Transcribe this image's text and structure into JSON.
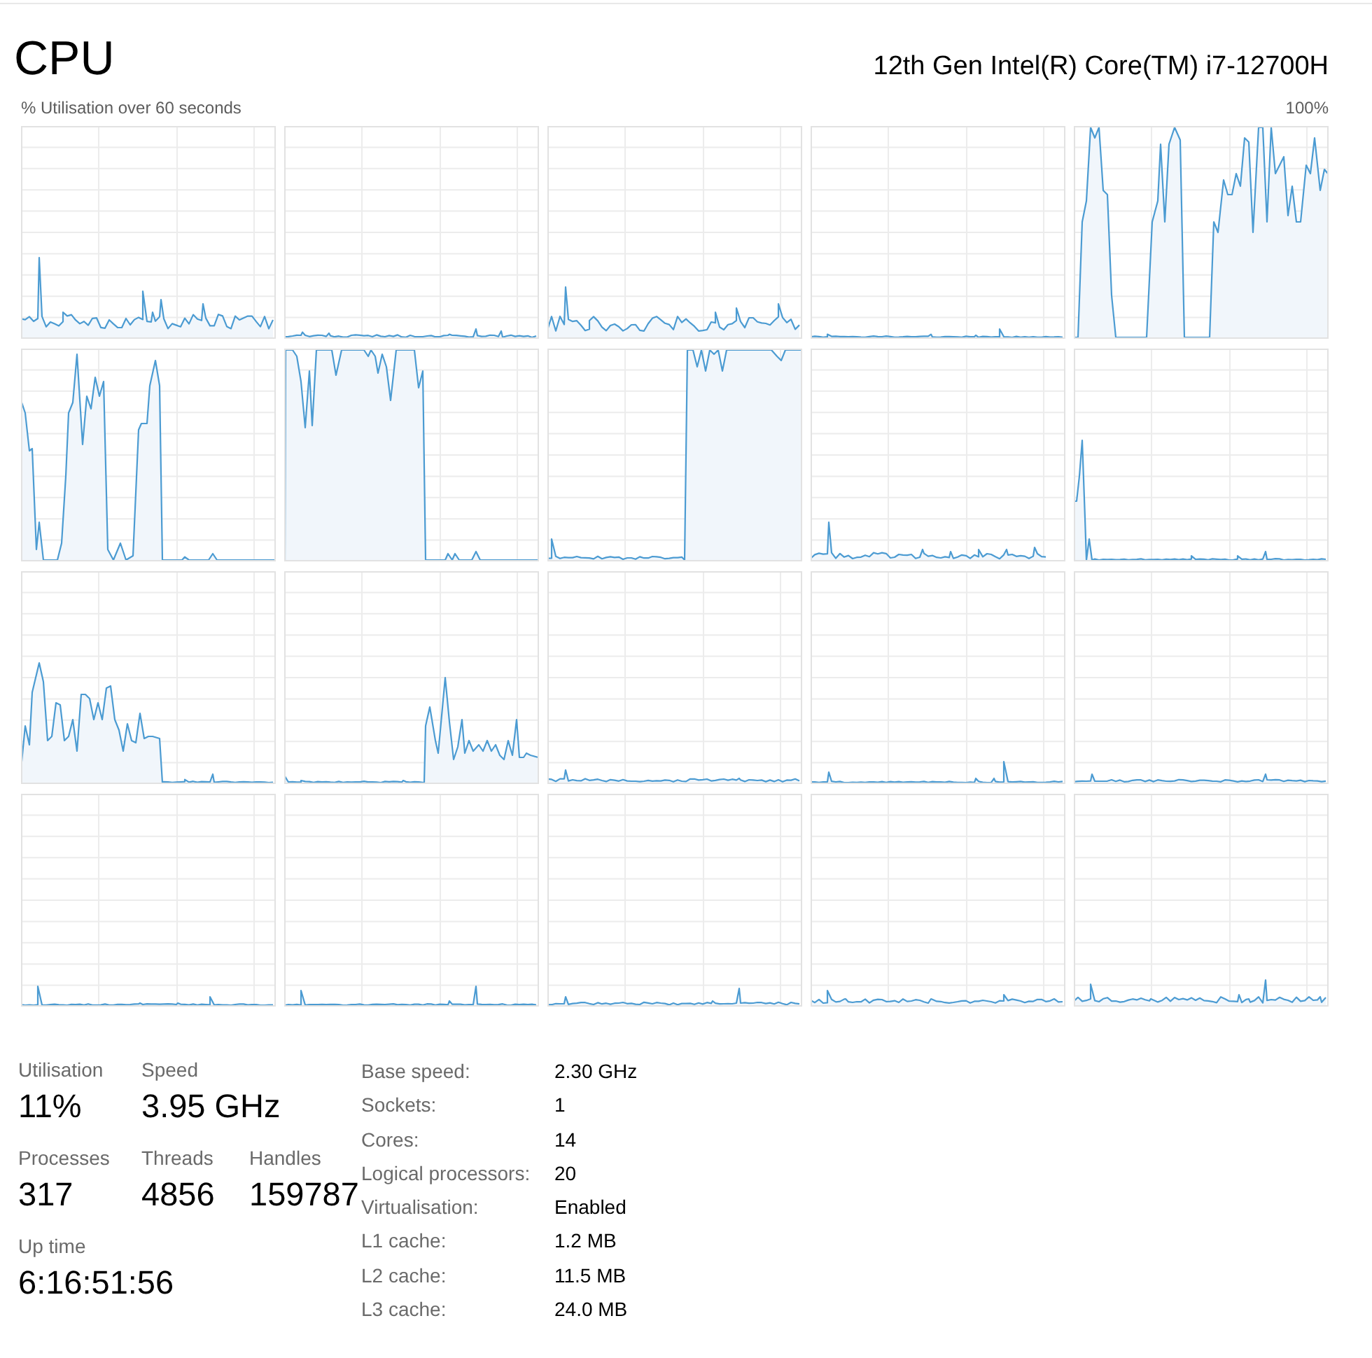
{
  "header": {
    "title": "CPU",
    "processor_name": "12th Gen Intel(R) Core(TM) i7-12700H"
  },
  "graphs": {
    "caption": "% Utilisation over 60 seconds",
    "max_label": "100%"
  },
  "stat_rows": [
    [
      {
        "label": "Utilisation",
        "value": "11%"
      },
      {
        "label": "Speed",
        "value": "3.95 GHz"
      }
    ],
    [
      {
        "label": "Processes",
        "value": "317"
      },
      {
        "label": "Threads",
        "value": "4856"
      },
      {
        "label": "Handles",
        "value": "159787"
      }
    ],
    [
      {
        "label": "Up time",
        "value": "6:16:51:56"
      }
    ]
  ],
  "details": [
    {
      "label": "Base speed:",
      "value": "2.30 GHz"
    },
    {
      "label": "Sockets:",
      "value": "1"
    },
    {
      "label": "Cores:",
      "value": "14"
    },
    {
      "label": "Logical processors:",
      "value": "20"
    },
    {
      "label": "Virtualisation:",
      "value": "Enabled"
    },
    {
      "label": "L1 cache:",
      "value": "1.2 MB"
    },
    {
      "label": "L2 cache:",
      "value": "11.5 MB"
    },
    {
      "label": "L3 cache:",
      "value": "24.0 MB"
    }
  ]
}
